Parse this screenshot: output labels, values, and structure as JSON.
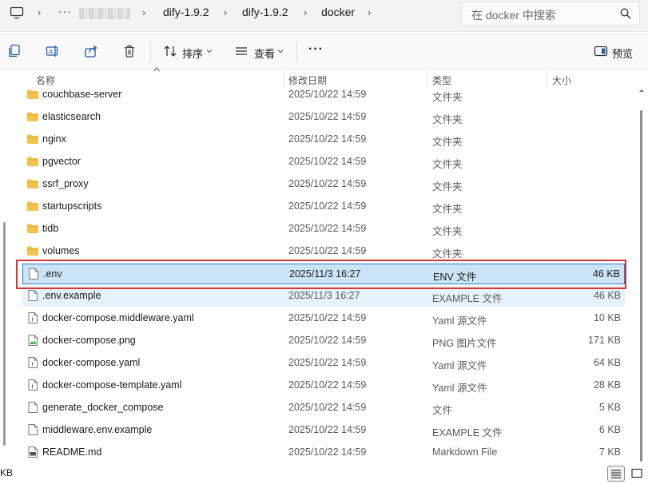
{
  "addressbar": {
    "dots": "···",
    "breadcrumb": [
      "dify-1.9.2",
      "dify-1.9.2",
      "docker"
    ],
    "search_placeholder": "在 docker 中搜索"
  },
  "toolbar": {
    "sort_label": "排序",
    "view_label": "查看",
    "more_label": "···",
    "preview_label": "预览"
  },
  "columns": {
    "name": "名称",
    "date": "修改日期",
    "type": "类型",
    "size": "大小"
  },
  "rows": [
    {
      "name": "couchbase-server",
      "date": "2025/10/22 14:59",
      "type": "文件夹",
      "size": "",
      "icon": "folder-icon"
    },
    {
      "name": "elasticsearch",
      "date": "2025/10/22 14:59",
      "type": "文件夹",
      "size": "",
      "icon": "folder-icon"
    },
    {
      "name": "nginx",
      "date": "2025/10/22 14:59",
      "type": "文件夹",
      "size": "",
      "icon": "folder-icon"
    },
    {
      "name": "pgvector",
      "date": "2025/10/22 14:59",
      "type": "文件夹",
      "size": "",
      "icon": "folder-icon"
    },
    {
      "name": "ssrf_proxy",
      "date": "2025/10/22 14:59",
      "type": "文件夹",
      "size": "",
      "icon": "folder-icon"
    },
    {
      "name": "startupscripts",
      "date": "2025/10/22 14:59",
      "type": "文件夹",
      "size": "",
      "icon": "folder-icon"
    },
    {
      "name": "tidb",
      "date": "2025/10/22 14:59",
      "type": "文件夹",
      "size": "",
      "icon": "folder-icon"
    },
    {
      "name": "volumes",
      "date": "2025/10/22 14:59",
      "type": "文件夹",
      "size": "",
      "icon": "folder-icon"
    },
    {
      "name": ".env",
      "date": "2025/11/3 16:27",
      "type": "ENV 文件",
      "size": "46 KB",
      "icon": "file-icon",
      "state": "selected"
    },
    {
      "name": ".env.example",
      "date": "2025/11/3 16:27",
      "type": "EXAMPLE 文件",
      "size": "46 KB",
      "icon": "file-icon",
      "state": "hover"
    },
    {
      "name": "docker-compose.middleware.yaml",
      "date": "2025/10/22 14:59",
      "type": "Yaml 源文件",
      "size": "10 KB",
      "icon": "yaml-file-icon"
    },
    {
      "name": "docker-compose.png",
      "date": "2025/10/22 14:59",
      "type": "PNG 图片文件",
      "size": "171 KB",
      "icon": "image-file-icon"
    },
    {
      "name": "docker-compose.yaml",
      "date": "2025/10/22 14:59",
      "type": "Yaml 源文件",
      "size": "64 KB",
      "icon": "yaml-file-icon"
    },
    {
      "name": "docker-compose-template.yaml",
      "date": "2025/10/22 14:59",
      "type": "Yaml 源文件",
      "size": "28 KB",
      "icon": "yaml-file-icon"
    },
    {
      "name": "generate_docker_compose",
      "date": "2025/10/22 14:59",
      "type": "文件",
      "size": "5 KB",
      "icon": "file-icon"
    },
    {
      "name": "middleware.env.example",
      "date": "2025/10/22 14:59",
      "type": "EXAMPLE 文件",
      "size": "6 KB",
      "icon": "file-icon"
    },
    {
      "name": "README.md",
      "date": "2025/10/22 14:59",
      "type": "Markdown File",
      "size": "7 KB",
      "icon": "markdown-file-icon"
    }
  ],
  "status": {
    "text": "KB"
  },
  "colors": {
    "selection": "#cce4f7",
    "selection_border": "#2b7dc4",
    "highlight_box": "#d8343b",
    "folder": "#f2c14e"
  }
}
